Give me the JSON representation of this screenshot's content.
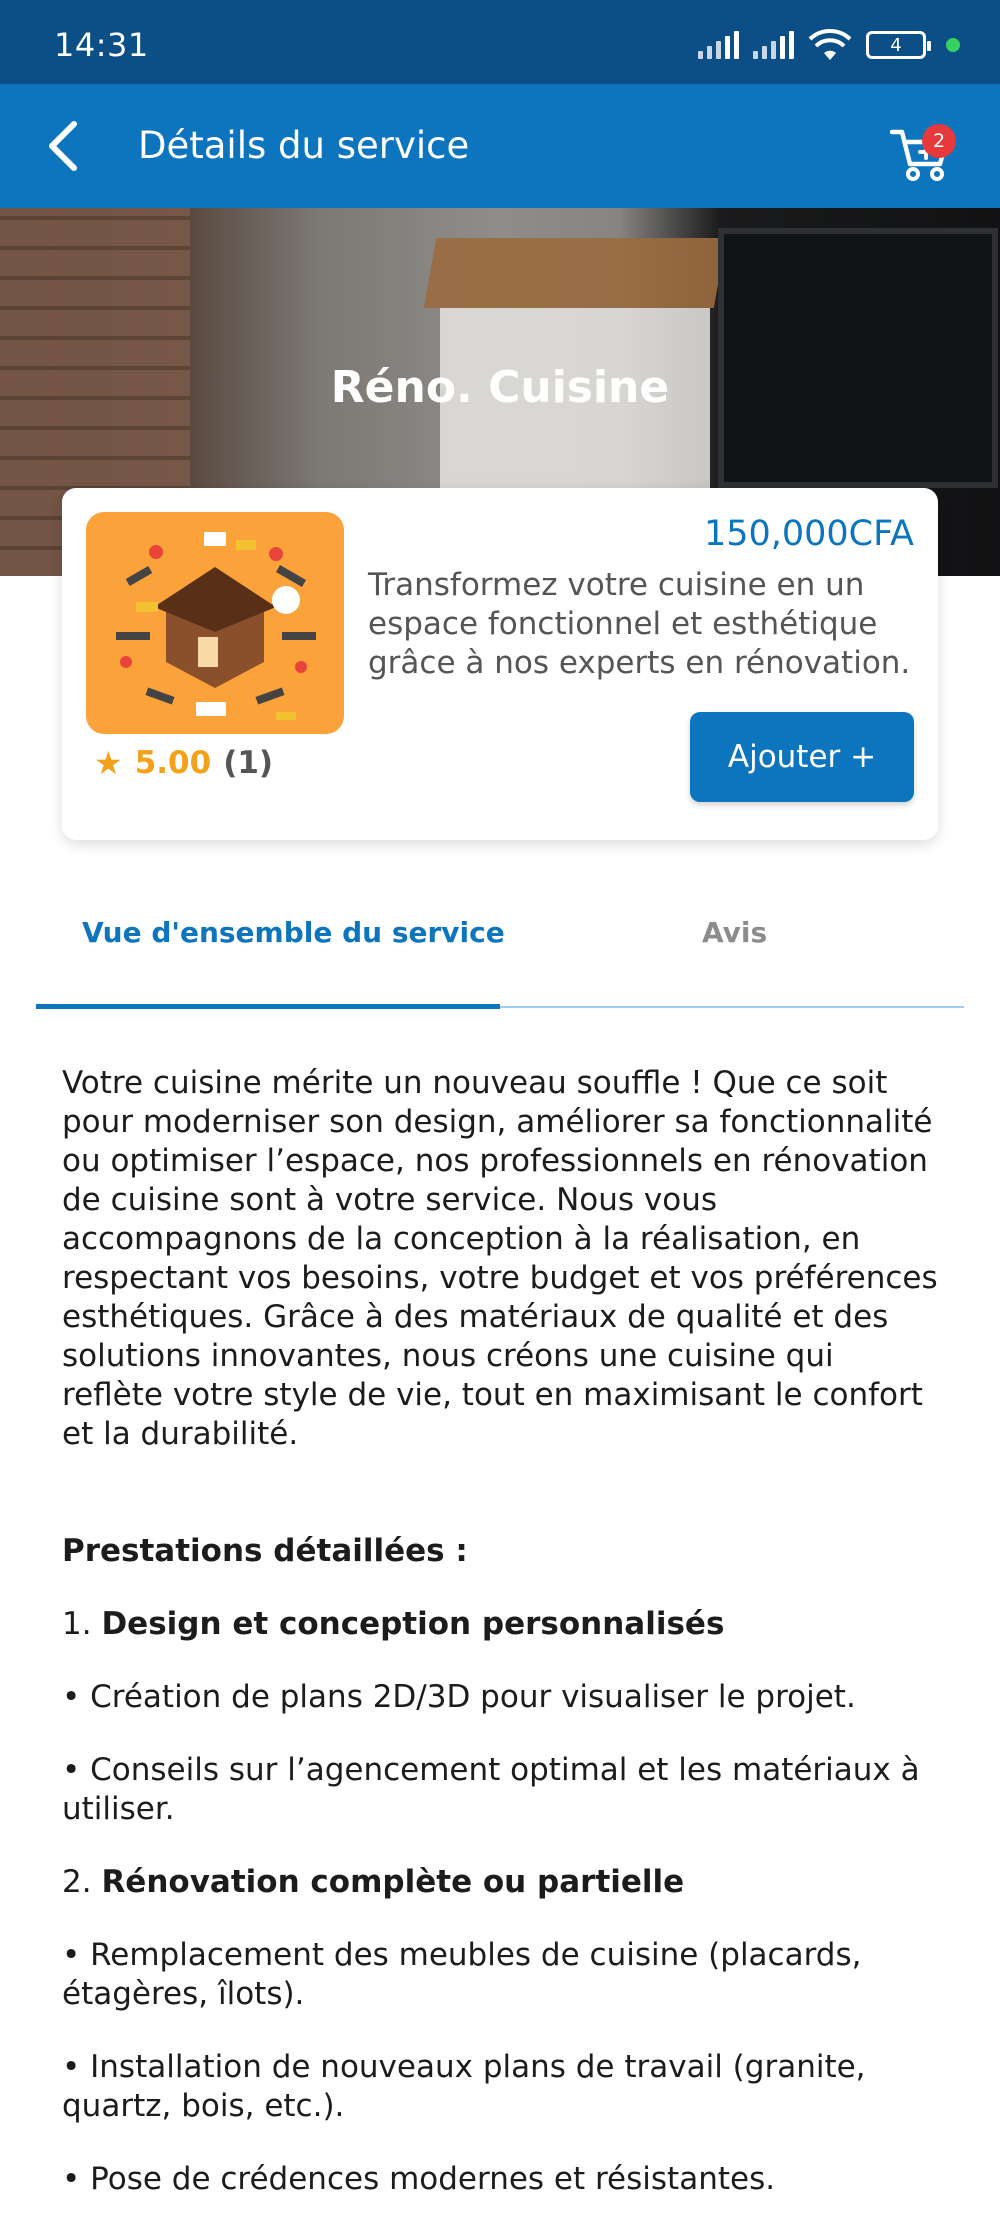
{
  "status_bar": {
    "time": "14:31",
    "battery": "4"
  },
  "header": {
    "title": "Détails du service",
    "cart_badge": "2"
  },
  "hero": {
    "title": "Réno. Cuisine"
  },
  "card": {
    "price": "150,000CFA",
    "description": "Transformez votre cuisine en un espace fonctionnel et esthétique grâce à nos experts en rénovation.",
    "rating_score": "5.00",
    "rating_count": "(1)",
    "add_button": "Ajouter +"
  },
  "tabs": {
    "overview": "Vue d'ensemble du service",
    "reviews": "Avis"
  },
  "content": {
    "intro": "Votre cuisine mérite un nouveau souffle ! Que ce soit pour moderniser son design, améliorer sa fonctionnalité ou optimiser l’espace, nos professionnels en rénovation de cuisine sont à votre service. Nous vous accompagnons de la conception à la réalisation, en respectant vos besoins, votre budget et vos préférences esthétiques. Grâce à des matériaux de qualité et des solutions innovantes, nous créons une cuisine qui reflète votre style de vie, tout en maximisant le confort et la durabilité.",
    "section_title": "Prestations détaillées :",
    "s1_num": "1. ",
    "s1_title": "Design et conception personnalisés",
    "b1": "• Création de plans 2D/3D pour visualiser le projet.",
    "b2": "• Conseils sur l’agencement optimal et les matériaux à utiliser.",
    "s2_num": "2. ",
    "s2_title": "Rénovation complète ou partielle",
    "b3": "• Remplacement des meubles de cuisine (placards, étagères, îlots).",
    "b4": "• Installation de nouveaux plans de travail (granite, quartz, bois, etc.).",
    "b5": "• Pose de crédences modernes et résistantes."
  },
  "colors": {
    "primary": "#0d75bd",
    "status_bar": "#0b4f86",
    "star": "#f1a21a",
    "badge": "#e6393b"
  }
}
